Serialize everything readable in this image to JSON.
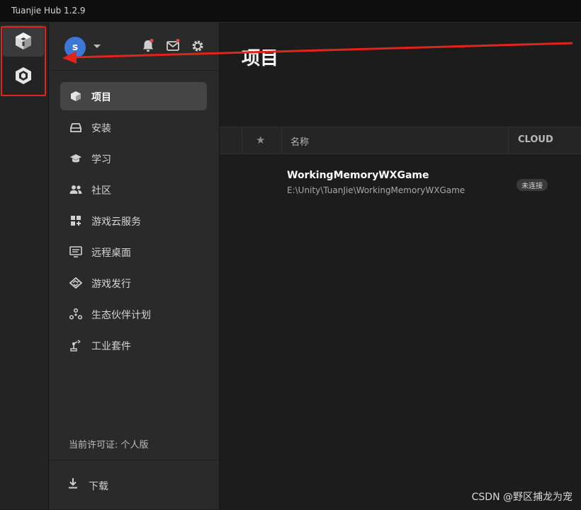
{
  "window": {
    "title": "Tuanjie Hub 1.2.9"
  },
  "rail": {
    "items": [
      {
        "icon": "cube-logo-icon"
      },
      {
        "icon": "tuanjie-logo-icon"
      }
    ]
  },
  "sidebar": {
    "avatar_initial": "s",
    "items": [
      {
        "label": "项目",
        "icon": "cube-icon",
        "active": true
      },
      {
        "label": "安装",
        "icon": "drive-icon"
      },
      {
        "label": "学习",
        "icon": "graduation-cap-icon"
      },
      {
        "label": "社区",
        "icon": "people-icon"
      },
      {
        "label": "游戏云服务",
        "icon": "grid-plus-icon"
      },
      {
        "label": "远程桌面",
        "icon": "monitor-icon"
      },
      {
        "label": "游戏发行",
        "icon": "handshake-icon"
      },
      {
        "label": "生态伙伴计划",
        "icon": "network-icon"
      },
      {
        "label": "工业套件",
        "icon": "robot-arm-icon"
      }
    ],
    "license": "当前许可证: 个人版",
    "download_label": "下载"
  },
  "main": {
    "title": "项目",
    "table": {
      "columns": {
        "star": "★",
        "name": "名称",
        "cloud": "CLOUD"
      },
      "rows": [
        {
          "name": "WorkingMemoryWXGame",
          "path": "E:\\Unity\\TuanJie\\WorkingMemoryWXGame",
          "cloud_status": "未连接"
        }
      ]
    }
  },
  "watermark": "CSDN @野区捕龙为宠",
  "colors": {
    "accent": "#3b78d8",
    "annotation_red": "#e3241b",
    "notification_dot": "#e04646"
  }
}
